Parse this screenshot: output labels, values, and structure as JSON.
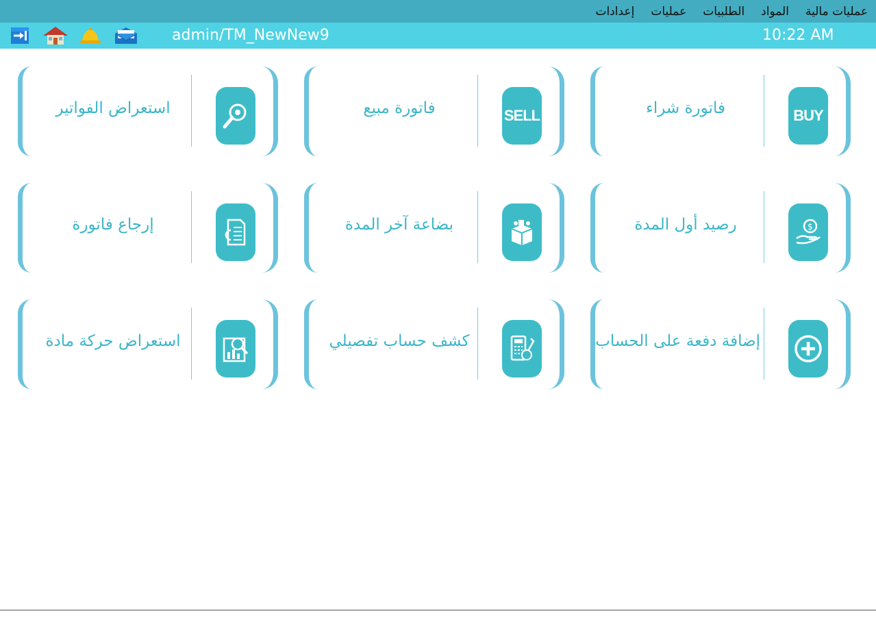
{
  "menu": {
    "items": [
      "عمليات مالية",
      "المواد",
      "الطلبيات",
      "عمليات",
      "إعدادات"
    ]
  },
  "toolbar": {
    "user": "admin/TM_NewNew9",
    "time": "10:22 AM",
    "icons": [
      "logout-icon",
      "home-icon",
      "bell-icon",
      "mail-icon"
    ]
  },
  "cards": [
    {
      "label": "فاتورة شراء",
      "icon_text": "BUY",
      "icon": "buy-icon"
    },
    {
      "label": "فاتورة مبيع",
      "icon_text": "SELL",
      "icon": "sell-icon"
    },
    {
      "label": "استعراض الفواتير",
      "icon_text": "",
      "icon": "magnifier-icon"
    },
    {
      "label": "رصيد أول المدة",
      "icon_text": "",
      "icon": "money-hand-icon"
    },
    {
      "label": "بضاعة آخر المدة",
      "icon_text": "",
      "icon": "goods-box-icon"
    },
    {
      "label": "إرجاع فاتورة",
      "icon_text": "",
      "icon": "invoice-return-icon"
    },
    {
      "label": "إضافة دفعة على الحساب",
      "icon_text": "",
      "icon": "plus-icon"
    },
    {
      "label": "كشف حساب تفصيلي",
      "icon_text": "",
      "icon": "calculator-icon"
    },
    {
      "label": "استعراض حركة مادة",
      "icon_text": "",
      "icon": "report-search-icon"
    }
  ],
  "colors": {
    "menubar": "#43acc0",
    "toolbar": "#4fd2e4",
    "accent": "#3dbcc8",
    "bracket": "#6cc3dd"
  }
}
